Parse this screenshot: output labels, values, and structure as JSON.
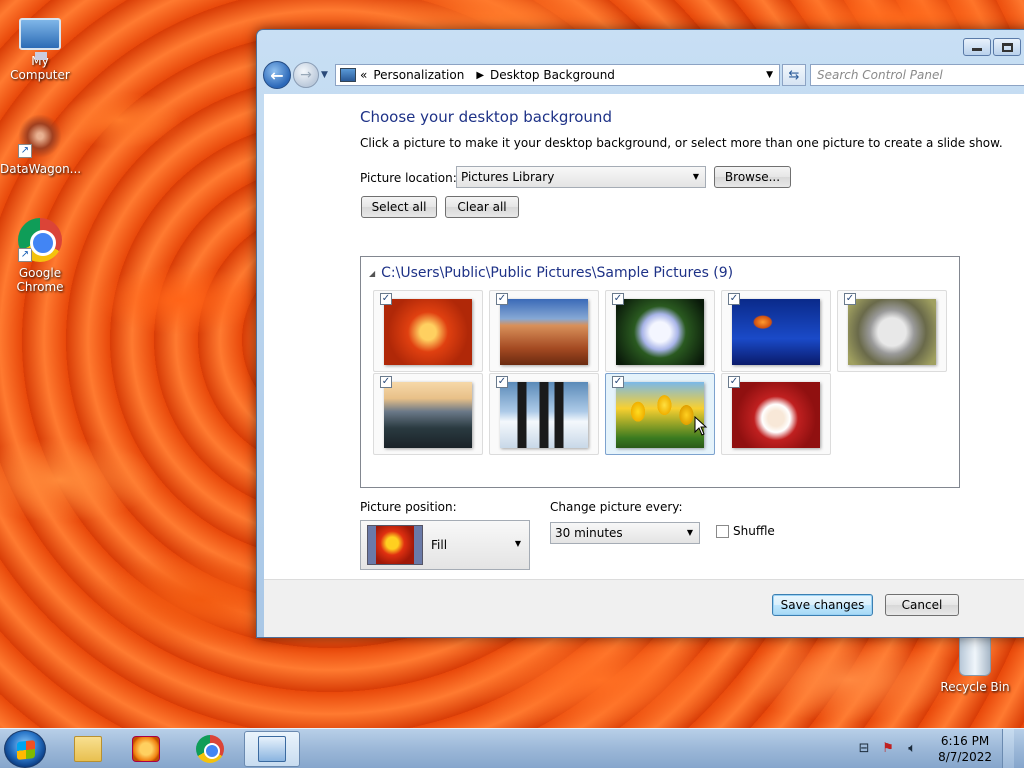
{
  "desktop": {
    "icons": [
      {
        "label": "My Computer",
        "icon": "computer-icon"
      },
      {
        "label": "DataWagon...",
        "icon": "datawagon-icon"
      },
      {
        "label": "Google Chrome",
        "icon": "chrome-icon"
      },
      {
        "label": "Recycle Bin",
        "icon": "recycle-bin-icon"
      }
    ]
  },
  "window": {
    "address": {
      "crumb_prefix": "«",
      "crumbs": [
        "Personalization",
        "Desktop Background"
      ]
    },
    "search_placeholder": "Search Control Panel",
    "title": "Choose your desktop background",
    "subtitle": "Click a picture to make it your desktop background, or select more than one picture to create a slide show.",
    "picture_location_label": "Picture location:",
    "picture_location_value": "Pictures Library",
    "browse_label": "Browse...",
    "select_all_label": "Select all",
    "clear_all_label": "Clear all",
    "group_title": "C:\\Users\\Public\\Public Pictures\\Sample Pictures (9)",
    "thumbnails": [
      {
        "name": "Chrysanthemum",
        "checked": true
      },
      {
        "name": "Desert",
        "checked": true
      },
      {
        "name": "Hydrangeas",
        "checked": true
      },
      {
        "name": "Jellyfish",
        "checked": true
      },
      {
        "name": "Koala",
        "checked": true
      },
      {
        "name": "Lighthouse",
        "checked": true
      },
      {
        "name": "Penguins",
        "checked": true
      },
      {
        "name": "Tulips",
        "checked": true
      },
      {
        "name": "Santa",
        "checked": true
      }
    ],
    "picture_position_label": "Picture position:",
    "picture_position_value": "Fill",
    "change_every_label": "Change picture every:",
    "change_every_value": "30 minutes",
    "shuffle_label": "Shuffle",
    "shuffle_checked": false,
    "save_label": "Save changes",
    "cancel_label": "Cancel"
  },
  "taskbar": {
    "time": "6:16 PM",
    "date": "8/7/2022"
  },
  "colors": {
    "heading": "#1e3287",
    "window_frame": "#a9c7e6",
    "taskbar": "#9cb8d8"
  }
}
